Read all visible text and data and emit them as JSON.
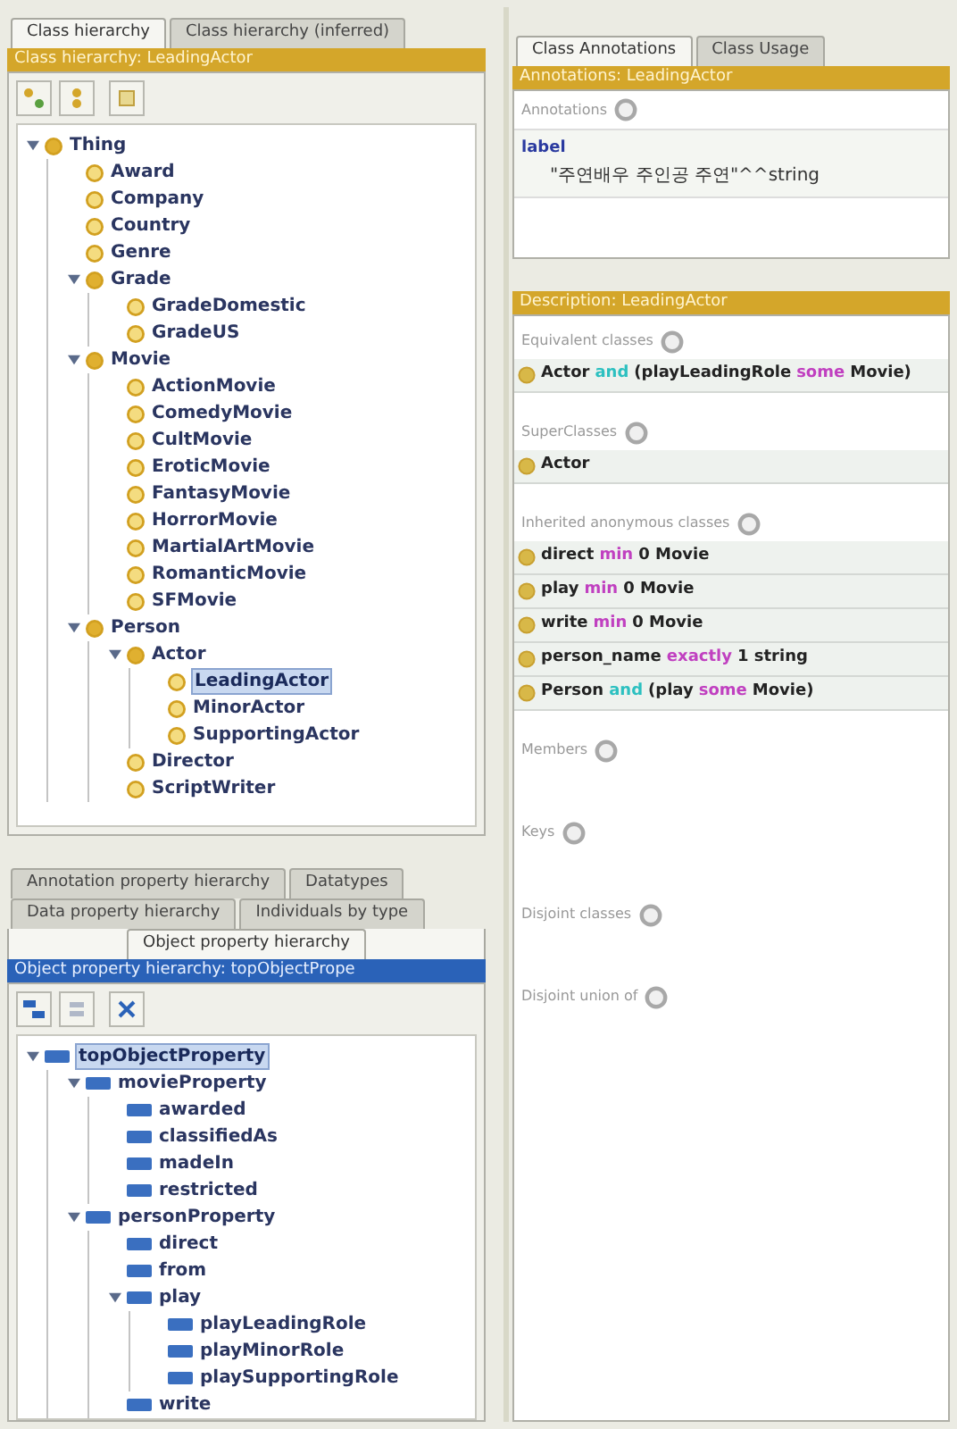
{
  "class_panel": {
    "tabs": [
      {
        "label": "Class hierarchy",
        "selected": true
      },
      {
        "label": "Class hierarchy (inferred)",
        "selected": false
      }
    ],
    "header": "Class hierarchy: LeadingActor",
    "tree": [
      {
        "label": "Thing",
        "expanded": true,
        "selected": false,
        "children": [
          {
            "label": "Award",
            "selected": false
          },
          {
            "label": "Company",
            "selected": false
          },
          {
            "label": "Country",
            "selected": false
          },
          {
            "label": "Genre",
            "selected": false
          },
          {
            "label": "Grade",
            "expanded": true,
            "selected": false,
            "children": [
              {
                "label": "GradeDomestic",
                "selected": false
              },
              {
                "label": "GradeUS",
                "selected": false
              }
            ]
          },
          {
            "label": "Movie",
            "expanded": true,
            "selected": false,
            "children": [
              {
                "label": "ActionMovie",
                "selected": false
              },
              {
                "label": "ComedyMovie",
                "selected": false
              },
              {
                "label": "CultMovie",
                "selected": false
              },
              {
                "label": "EroticMovie",
                "selected": false
              },
              {
                "label": "FantasyMovie",
                "selected": false
              },
              {
                "label": "HorrorMovie",
                "selected": false
              },
              {
                "label": "MartialArtMovie",
                "selected": false
              },
              {
                "label": "RomanticMovie",
                "selected": false
              },
              {
                "label": "SFMovie",
                "selected": false
              }
            ]
          },
          {
            "label": "Person",
            "expanded": true,
            "selected": false,
            "children": [
              {
                "label": "Actor",
                "expanded": true,
                "selected": false,
                "children": [
                  {
                    "label": "LeadingActor",
                    "selected": true
                  },
                  {
                    "label": "MinorActor",
                    "selected": false
                  },
                  {
                    "label": "SupportingActor",
                    "selected": false
                  }
                ]
              },
              {
                "label": "Director",
                "selected": false
              },
              {
                "label": "ScriptWriter",
                "selected": false
              }
            ]
          }
        ]
      }
    ]
  },
  "property_panel": {
    "tab_rows": [
      [
        {
          "label": "Annotation property hierarchy",
          "selected": false
        },
        {
          "label": "Datatypes",
          "selected": false
        }
      ],
      [
        {
          "label": "Data property hierarchy",
          "selected": false
        },
        {
          "label": "Individuals by type",
          "selected": false
        }
      ],
      [
        {
          "label": "Object property hierarchy",
          "selected": true
        }
      ]
    ],
    "header": "Object property hierarchy: topObjectPrope",
    "tree": [
      {
        "label": "topObjectProperty",
        "expanded": true,
        "selected": true,
        "children": [
          {
            "label": "movieProperty",
            "expanded": true,
            "selected": false,
            "children": [
              {
                "label": "awarded",
                "selected": false
              },
              {
                "label": "classifiedAs",
                "selected": false
              },
              {
                "label": "madeIn",
                "selected": false
              },
              {
                "label": "restricted",
                "selected": false
              }
            ]
          },
          {
            "label": "personProperty",
            "expanded": true,
            "selected": false,
            "children": [
              {
                "label": "direct",
                "selected": false
              },
              {
                "label": "from",
                "selected": false
              },
              {
                "label": "play",
                "expanded": true,
                "selected": false,
                "children": [
                  {
                    "label": "playLeadingRole",
                    "selected": false
                  },
                  {
                    "label": "playMinorRole",
                    "selected": false
                  },
                  {
                    "label": "playSupportingRole",
                    "selected": false
                  }
                ]
              },
              {
                "label": "write",
                "selected": false
              }
            ]
          }
        ]
      }
    ]
  },
  "annotation_panel": {
    "tabs": [
      {
        "label": "Class Annotations",
        "selected": true
      },
      {
        "label": "Class Usage",
        "selected": false
      }
    ],
    "header": "Annotations: LeadingActor",
    "section": "Annotations",
    "property": "label",
    "value": "\"주연배우 주인공 주연\"^^string"
  },
  "description_panel": {
    "header": "Description: LeadingActor",
    "sections": [
      {
        "title": "Equivalent classes",
        "items": [
          [
            {
              "text": "Actor",
              "kind": "name"
            },
            {
              "text": "and",
              "kind": "logic"
            },
            {
              "text": "(playLeadingRole",
              "kind": "name"
            },
            {
              "text": "some",
              "kind": "quantifier"
            },
            {
              "text": "Movie)",
              "kind": "name"
            }
          ]
        ]
      },
      {
        "title": "SuperClasses",
        "items": [
          [
            {
              "text": "Actor",
              "kind": "name"
            }
          ]
        ]
      },
      {
        "title": "Inherited anonymous classes",
        "items": [
          [
            {
              "text": "direct",
              "kind": "name"
            },
            {
              "text": "min",
              "kind": "quantifier"
            },
            {
              "text": "0 Movie",
              "kind": "name"
            }
          ],
          [
            {
              "text": "play",
              "kind": "name"
            },
            {
              "text": "min",
              "kind": "quantifier"
            },
            {
              "text": "0 Movie",
              "kind": "name"
            }
          ],
          [
            {
              "text": "write",
              "kind": "name"
            },
            {
              "text": "min",
              "kind": "quantifier"
            },
            {
              "text": "0 Movie",
              "kind": "name"
            }
          ],
          [
            {
              "text": "person_name",
              "kind": "name"
            },
            {
              "text": "exactly",
              "kind": "quantifier"
            },
            {
              "text": "1 string",
              "kind": "name"
            }
          ],
          [
            {
              "text": "Person",
              "kind": "name"
            },
            {
              "text": "and",
              "kind": "logic"
            },
            {
              "text": "(play",
              "kind": "name"
            },
            {
              "text": "some",
              "kind": "quantifier"
            },
            {
              "text": "Movie)",
              "kind": "name"
            }
          ]
        ]
      },
      {
        "title": "Members"
      },
      {
        "title": "Keys"
      },
      {
        "title": "Disjoint classes"
      },
      {
        "title": "Disjoint union of"
      }
    ]
  }
}
